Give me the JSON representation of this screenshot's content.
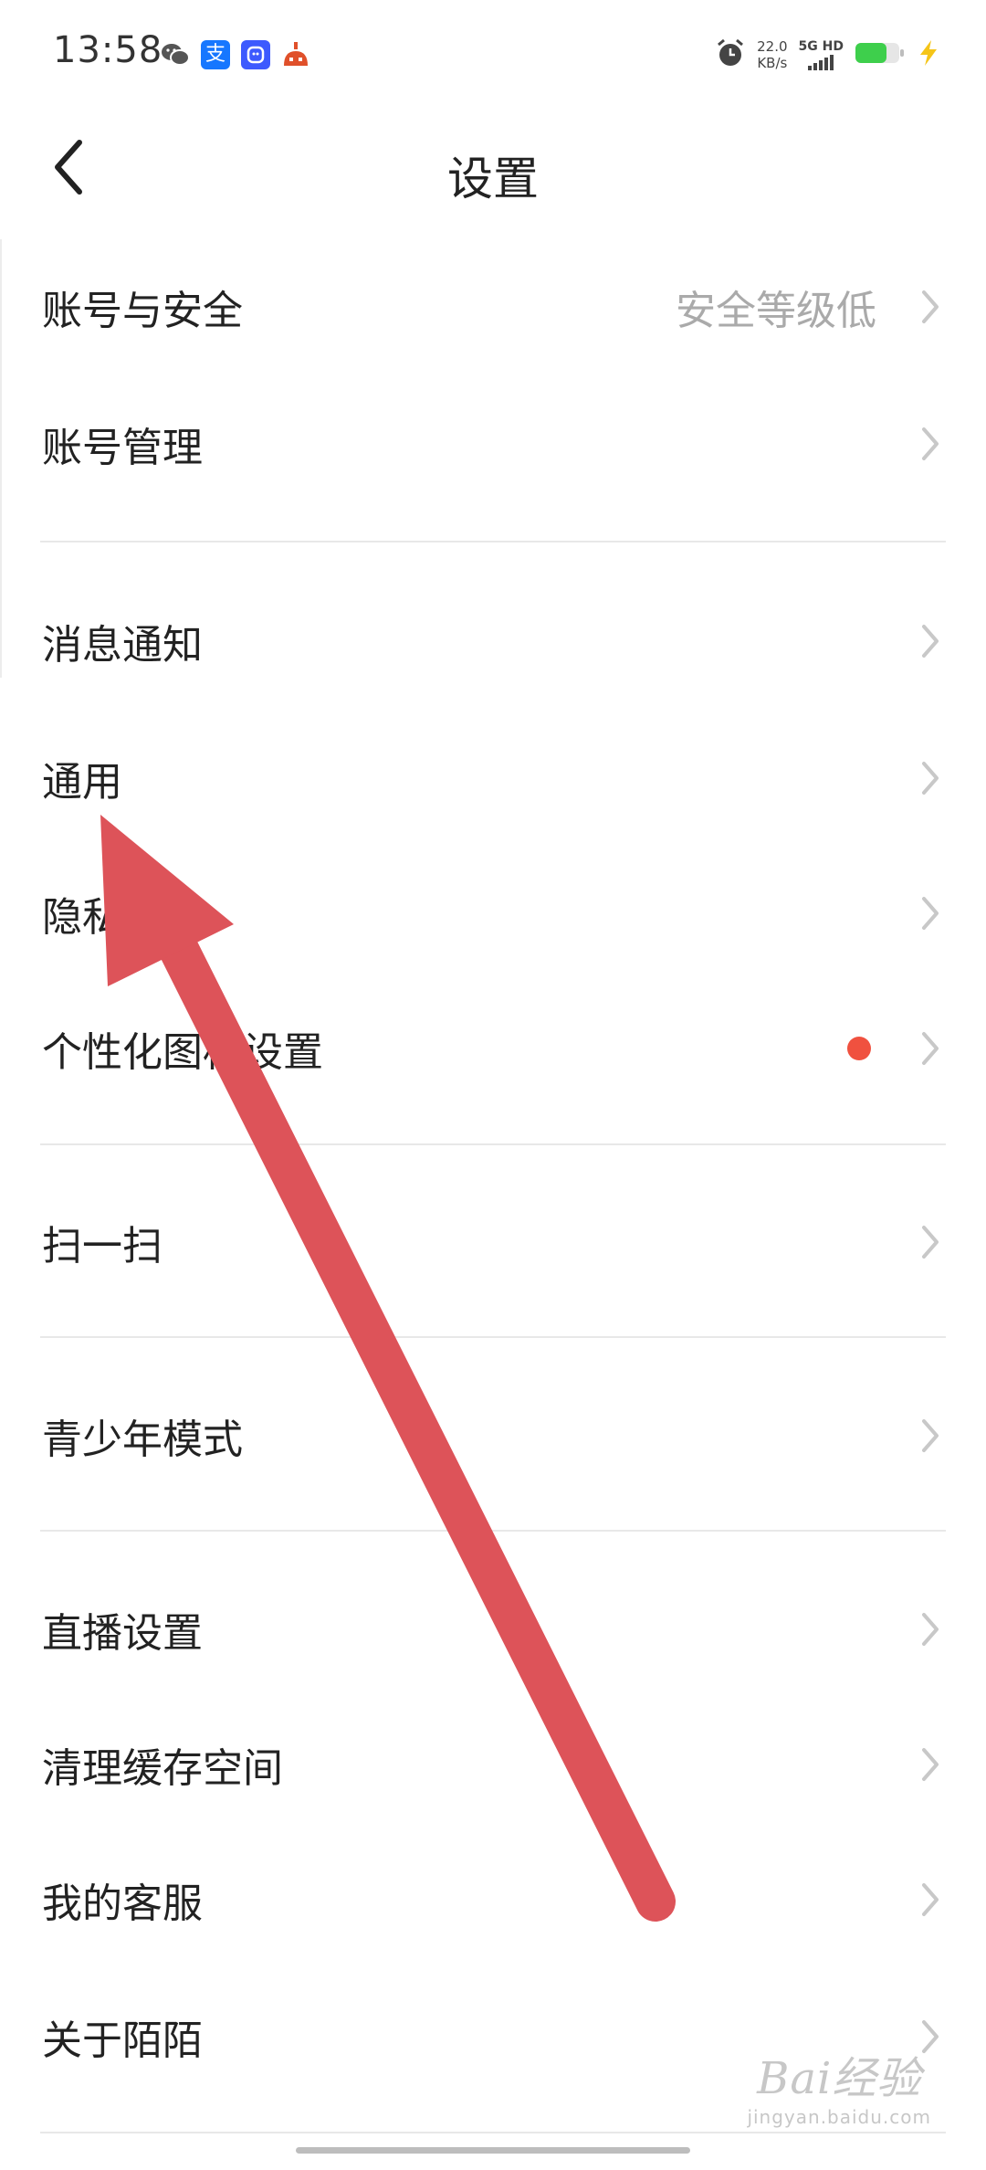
{
  "status_bar": {
    "time": "13:58",
    "apps": [
      {
        "name": "wechat-icon",
        "glyph": "",
        "color": "#555555"
      },
      {
        "name": "alipay-icon",
        "glyph": "支",
        "color": "#1677ff"
      },
      {
        "name": "qq-icon",
        "glyph": "",
        "color": "#3d5afe"
      },
      {
        "name": "app-notification-icon",
        "glyph": "",
        "color": "#e0502a"
      }
    ],
    "net_speed_value": "22.0",
    "net_speed_unit": "KB/s",
    "network_type": "5G HD",
    "battery_color": "#3ecf4c",
    "charging_color": "#f5c518"
  },
  "header": {
    "title": "设置"
  },
  "settings": {
    "account_security": {
      "label": "账号与安全",
      "value": "安全等级低"
    },
    "account_manage": {
      "label": "账号管理"
    },
    "notifications": {
      "label": "消息通知"
    },
    "general": {
      "label": "通用"
    },
    "privacy": {
      "label": "隐私"
    },
    "personalized_icon": {
      "label": "个性化图标设置",
      "dot_color": "#f0513f"
    },
    "scan": {
      "label": "扫一扫"
    },
    "teen_mode": {
      "label": "青少年模式"
    },
    "live_settings": {
      "label": "直播设置"
    },
    "clear_cache": {
      "label": "清理缓存空间"
    },
    "customer_service": {
      "label": "我的客服"
    },
    "about": {
      "label": "关于陌陌"
    }
  },
  "annotation": {
    "arrow_color": "#dd5359"
  },
  "watermark": {
    "logo": "Bai经验",
    "url": "jingyan.baidu.com"
  }
}
